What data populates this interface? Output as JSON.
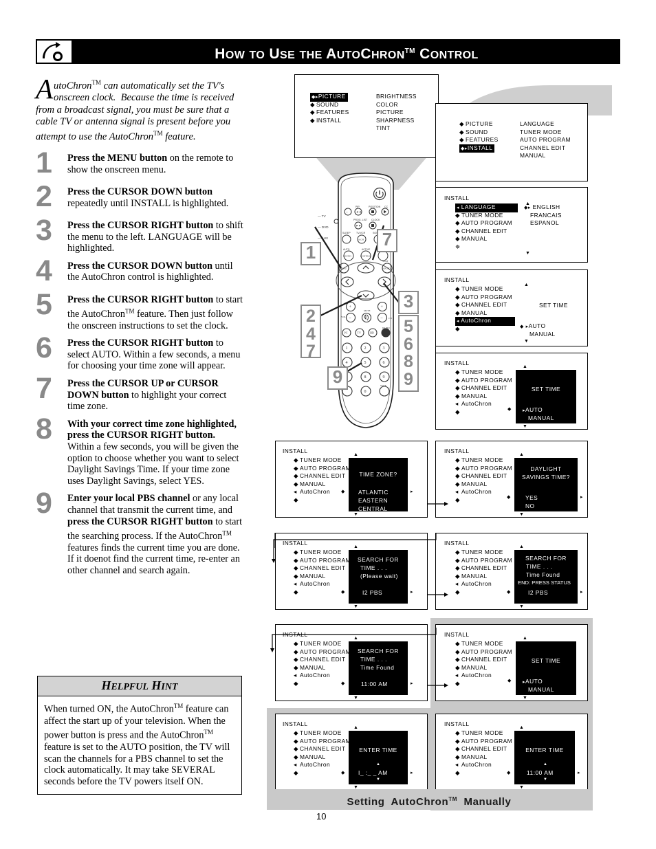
{
  "header": {
    "title_parts": [
      "How",
      "to",
      "Use",
      "the",
      "AutoChron",
      "Control"
    ],
    "title_plain": "HOW TO USE THE AUTOCHRON™ CONTROL",
    "logo_icon": "philips-shield-icon"
  },
  "intro": {
    "dropcap": "A",
    "text": "utoChron™ can automatically set the TV's onscreen clock.  Because the time is received from a broadcast signal, you must be sure that a cable TV or antenna signal is present before you attempt to use the AutoChron™ feature."
  },
  "steps": [
    {
      "num": "1",
      "bold": "Press the MENU button",
      "rest": " on the remote to show the onscreen menu."
    },
    {
      "num": "2",
      "bold": "Press the CURSOR DOWN button",
      "rest": " repeatedly until INSTALL is highlighted."
    },
    {
      "num": "3",
      "bold": "Press the CURSOR RIGHT button",
      "rest": " to shift the menu to the left. LANGUAGE will be highlighted."
    },
    {
      "num": "4",
      "bold": "Press the CURSOR DOWN button",
      "rest": " until the AutoChron control is highlighted."
    },
    {
      "num": "5",
      "bold": "Press the CURSOR RIGHT button",
      "rest": " to start the AutoChron™ feature. Then just follow the onscreen instructions to set the clock."
    },
    {
      "num": "6",
      "bold": "Press the CURSOR RIGHT button",
      "rest": " to select AUTO.  Within a few seconds, a menu for choosing your time zone will appear."
    },
    {
      "num": "7",
      "bold": "Press the CURSOR UP or CURSOR DOWN button",
      "rest": " to highlight your correct time zone."
    },
    {
      "num": "8",
      "bold": "With your correct time zone highlighted, press the CURSOR RIGHT button.",
      "rest": "  Within a few seconds, you will be given the option to choose whether you want to select Daylight Savings Time. If your time zone uses Daylight Savings, select YES."
    },
    {
      "num": "9",
      "bold": "Enter your local PBS channel",
      "rest": " or any local channel that transmit the current time, and ",
      "bold2": "press the CURSOR RIGHT button",
      "rest2": " to start the searching process. If the AutoChron™ features finds the current time you are done. If it doenot find the current time, re-enter an other channel and search again."
    }
  ],
  "hint": {
    "title": "HELPFUL HINT",
    "body": "When turned ON, the AutoChron™ feature can affect the start up of your television. When the power button is press and the AutoChron™ feature is set to the AUTO position, the TV will scan the channels for a PBS channel to set the clock automatically. It may take SEVERAL seconds before the TV powers itself ON."
  },
  "screens": {
    "s1": {
      "left": [
        "PICTURE",
        "SOUND",
        "FEATURES",
        "INSTALL"
      ],
      "left_highlight": "PICTURE",
      "right": [
        "BRIGHTNESS",
        "COLOR",
        "PICTURE",
        "SHARPNESS",
        "TINT"
      ]
    },
    "s2": {
      "left": [
        "PICTURE",
        "SOUND",
        "FEATURES",
        "INSTALL"
      ],
      "left_highlight": "INSTALL",
      "right": [
        "LANGUAGE",
        "TUNER MODE",
        "AUTO PROGRAM",
        "CHANNEL EDIT",
        "MANUAL"
      ]
    },
    "s3": {
      "title": "INSTALL",
      "left": [
        "LANGUAGE",
        "TUNER MODE",
        "AUTO PROGRAM",
        "CHANNEL EDIT",
        "MANUAL"
      ],
      "left_highlight": "LANGUAGE",
      "right": [
        "ENGLISH",
        "FRANCAIS",
        "ESPANOL"
      ],
      "right_cursor": "ENGLISH"
    },
    "s4": {
      "title": "INSTALL",
      "left": [
        "TUNER MODE",
        "AUTO PROGRAM",
        "CHANNEL EDIT",
        "MANUAL",
        "AutoChron"
      ],
      "left_highlight": "AutoChron",
      "panel_title": "SET TIME",
      "panel_options": [
        "AUTO",
        "MANUAL"
      ],
      "panel_cursor": "AUTO",
      "panel_black": false
    },
    "s5": {
      "title": "INSTALL",
      "left": [
        "TUNER MODE",
        "AUTO PROGRAM",
        "CHANNEL EDIT",
        "MANUAL",
        "AutoChron"
      ],
      "panel_title": "SET TIME",
      "panel_options": [
        "AUTO",
        "MANUAL"
      ],
      "panel_cursor": "AUTO",
      "panel_black": true
    },
    "s6": {
      "title": "INSTALL",
      "left": [
        "TUNER MODE",
        "AUTO PROGRAM",
        "CHANNEL EDIT",
        "MANUAL",
        "AutoChron"
      ],
      "panel_title": "TIME ZONE?",
      "panel_options": [
        "ATLANTIC",
        "EASTERN",
        "CENTRAL"
      ],
      "panel_cursor": "EASTERN"
    },
    "s7": {
      "title": "INSTALL",
      "left": [
        "TUNER MODE",
        "AUTO PROGRAM",
        "CHANNEL EDIT",
        "MANUAL",
        "AutoChron"
      ],
      "panel_title_l1": "DAYLIGHT",
      "panel_title_l2": "SAVINGS TIME?",
      "panel_options": [
        "YES",
        "NO"
      ],
      "panel_cursor": "YES"
    },
    "s8": {
      "title": "INSTALL",
      "left": [
        "TUNER MODE",
        "AUTO PROGRAM",
        "CHANNEL EDIT",
        "MANUAL",
        "AutoChron"
      ],
      "panel_lines": [
        "SEARCH FOR",
        "TIME . . .",
        "(Please wait)"
      ],
      "panel_value": "I2 PBS"
    },
    "s9": {
      "title": "INSTALL",
      "left": [
        "TUNER MODE",
        "AUTO PROGRAM",
        "CHANNEL EDIT",
        "MANUAL",
        "AutoChron"
      ],
      "panel_lines": [
        "SEARCH FOR",
        "TIME . . .",
        "Time Found",
        "END: PRESS STATUS"
      ],
      "panel_value": "I2 PBS"
    },
    "s10": {
      "title": "INSTALL",
      "left": [
        "TUNER MODE",
        "AUTO PROGRAM",
        "CHANNEL EDIT",
        "MANUAL",
        "AutoChron"
      ],
      "panel_lines": [
        "SEARCH FOR",
        "TIME . . .",
        "Time Found"
      ],
      "panel_value": "11:00 AM"
    },
    "s11": {
      "title": "INSTALL",
      "left": [
        "TUNER MODE",
        "AUTO PROGRAM",
        "CHANNEL EDIT",
        "MANUAL",
        "AutoChron"
      ],
      "panel_title": "SET TIME",
      "panel_options": [
        "AUTO",
        "MANUAL"
      ],
      "panel_cursor": "AUTO",
      "panel_black": true
    },
    "s12": {
      "title": "INSTALL",
      "left": [
        "TUNER MODE",
        "AUTO PROGRAM",
        "CHANNEL EDIT",
        "MANUAL",
        "AutoChron"
      ],
      "panel_title": "ENTER TIME",
      "panel_value": "I_ :_ _ AM"
    },
    "s13": {
      "title": "INSTALL",
      "left": [
        "TUNER MODE",
        "AUTO PROGRAM",
        "CHANNEL EDIT",
        "MANUAL",
        "AutoChron"
      ],
      "panel_title": "ENTER TIME",
      "panel_value": "11:00 AM"
    }
  },
  "remote": {
    "callouts": [
      "1",
      "7",
      "3",
      "2 4 7",
      "3 5 6 8 9",
      "9"
    ],
    "labels_top": [
      "PIP",
      "POSITION",
      "CC",
      "PROG. LIST",
      "CLOCK",
      "SLEEP",
      "TV/VCR",
      "SOURCE",
      "A.CH",
      "AUTO SOUND",
      "ACTIVE CONTROL",
      "MENU",
      "SURF",
      "SOUND",
      "MUTE",
      "VOL",
      "CH",
      "PC",
      "TV",
      "HD",
      "RADIO",
      "TEXT",
      "SURF"
    ],
    "keypad": [
      "1",
      "2",
      "3",
      "4",
      "5",
      "6",
      "7",
      "8",
      "9",
      "0"
    ],
    "side_labels": [
      "TV",
      "DVD",
      "AUX"
    ]
  },
  "caption": {
    "text": "Setting AutoChron™ Manually"
  },
  "page_number": "10",
  "colors": {
    "header_bar": "#000000",
    "step_number": "#898989",
    "hint_title_bg": "#d3d3d3",
    "caption_bg": "#c9c9c9",
    "callout_border": "#8a8a8a"
  }
}
